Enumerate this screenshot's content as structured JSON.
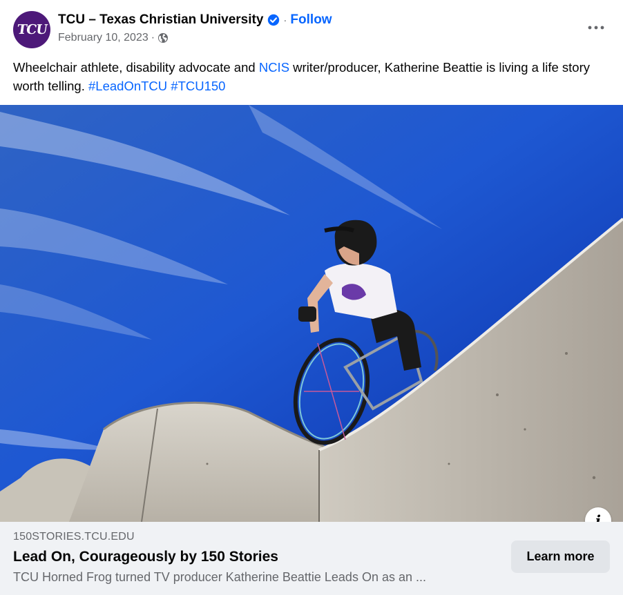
{
  "post": {
    "page_name": "TCU – Texas Christian University",
    "avatar_text": "TCU",
    "separator": "·",
    "follow_label": "Follow",
    "date": "February 10, 2023",
    "audience_icon": "globe-icon",
    "verified_icon": "verified-badge-icon",
    "more_icon": "more-options-icon",
    "caption": {
      "part1": "Wheelchair athlete, disability advocate and ",
      "mention": "NCIS",
      "part2": " writer/producer, Katherine Beattie is living a life story worth telling. ",
      "hashtag1": "#LeadOnTCU",
      "hashtag2": "#TCU150"
    },
    "info_label": "i"
  },
  "link_card": {
    "domain": "150STORIES.TCU.EDU",
    "title": "Lead On, Courageously by 150 Stories",
    "description": "TCU Horned Frog turned TV producer Katherine Beattie Leads On as an ...",
    "cta_label": "Learn more"
  },
  "colors": {
    "brand_purple": "#4d1979",
    "link_blue": "#0866ff",
    "secondary_text": "#65676b",
    "card_background": "#f0f2f5"
  }
}
